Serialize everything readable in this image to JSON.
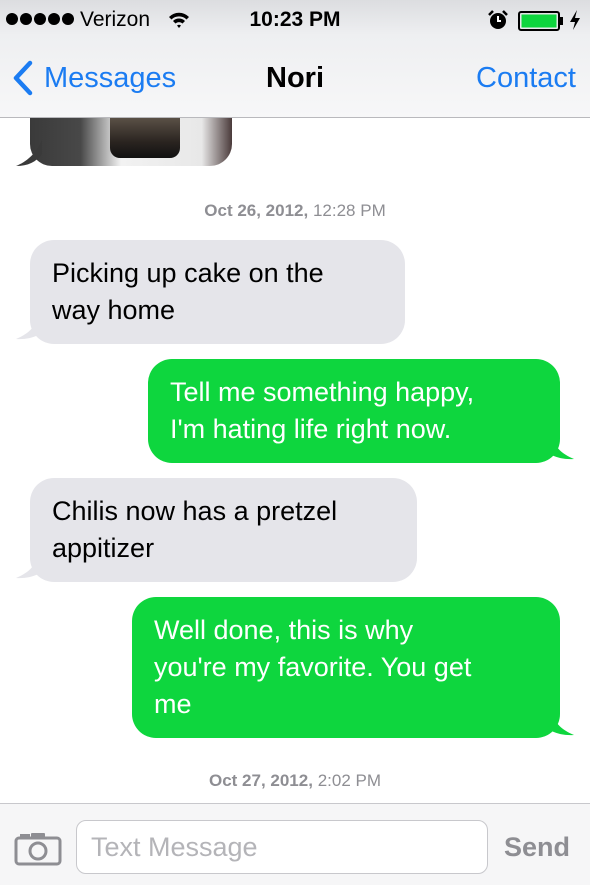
{
  "status_bar": {
    "signal_bars": 5,
    "carrier": "Verizon",
    "time": "10:23 PM",
    "icons": [
      "wifi-icon",
      "alarm-icon",
      "battery-icon",
      "charging-icon"
    ]
  },
  "nav": {
    "back_label": "Messages",
    "title": "Nori",
    "contact_label": "Contact"
  },
  "conversation": {
    "timestamps": [
      {
        "date": "Oct 26, 2012,",
        "time": "12:28 PM"
      },
      {
        "date": "Oct 27, 2012,",
        "time": "2:02 PM"
      }
    ],
    "messages": [
      {
        "direction": "incoming",
        "lines": [
          "Picking up cake on the",
          "way home"
        ]
      },
      {
        "direction": "outgoing",
        "lines": [
          "Tell me something happy,",
          "I'm hating life right now."
        ]
      },
      {
        "direction": "incoming",
        "lines": [
          "Chilis now has a pretzel",
          "appitizer"
        ]
      },
      {
        "direction": "outgoing",
        "lines": [
          "Well done, this is why",
          "you're my favorite. You get",
          "me"
        ]
      }
    ]
  },
  "input_bar": {
    "placeholder": "Text Message",
    "value": "",
    "send_label": "Send"
  },
  "colors": {
    "accent": "#1b7cf2",
    "incoming_bubble": "#e5e5ea",
    "outgoing_bubble": "#0ed63e",
    "timestamp_text": "#8e8e93"
  }
}
